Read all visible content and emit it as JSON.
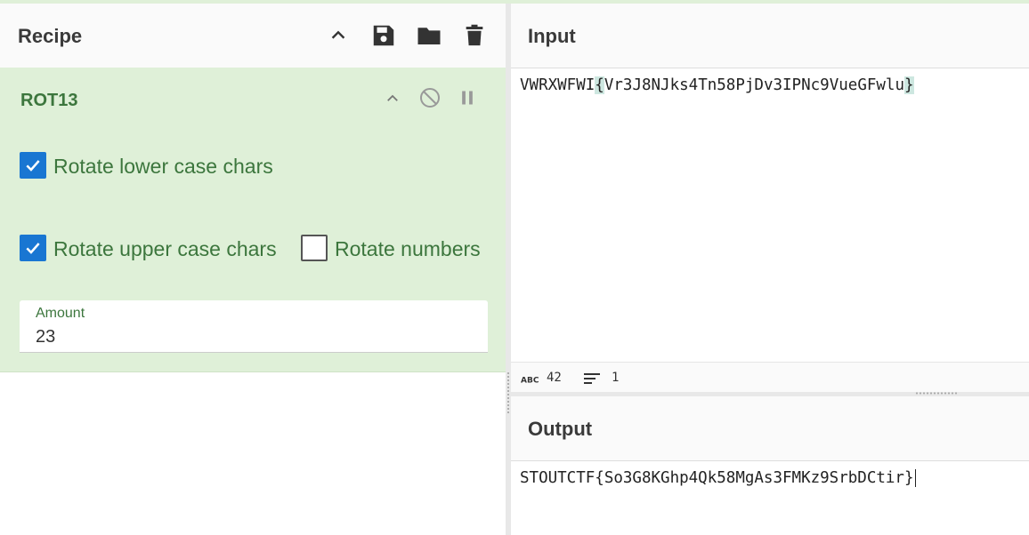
{
  "recipe": {
    "title": "Recipe",
    "header_icons": [
      "chevron-up-icon",
      "save-icon",
      "folder-icon",
      "trash-icon"
    ],
    "operation": {
      "name": "ROT13",
      "rotate_lower": {
        "label": "Rotate lower case chars",
        "checked": true
      },
      "rotate_upper": {
        "label": "Rotate upper case chars",
        "checked": true
      },
      "rotate_numbers": {
        "label": "Rotate numbers",
        "checked": false
      },
      "amount": {
        "label": "Amount",
        "value": "23"
      }
    }
  },
  "input": {
    "title": "Input",
    "prefix": "VWRXWFWI",
    "open_brace": "{",
    "body": "Vr3J8NJks4Tn58PjDv3IPNc9VueGFwlu",
    "close_brace": "}",
    "status": {
      "chars": "42",
      "lines": "1"
    }
  },
  "output": {
    "title": "Output",
    "text": "STOUTCTF{So3G8KGhp4Qk58MgAs3FMKz9SrbDCtir}"
  },
  "colors": {
    "accent_green": "#3c763d",
    "op_background": "#dff0d8",
    "checkbox_blue": "#1976d2"
  }
}
